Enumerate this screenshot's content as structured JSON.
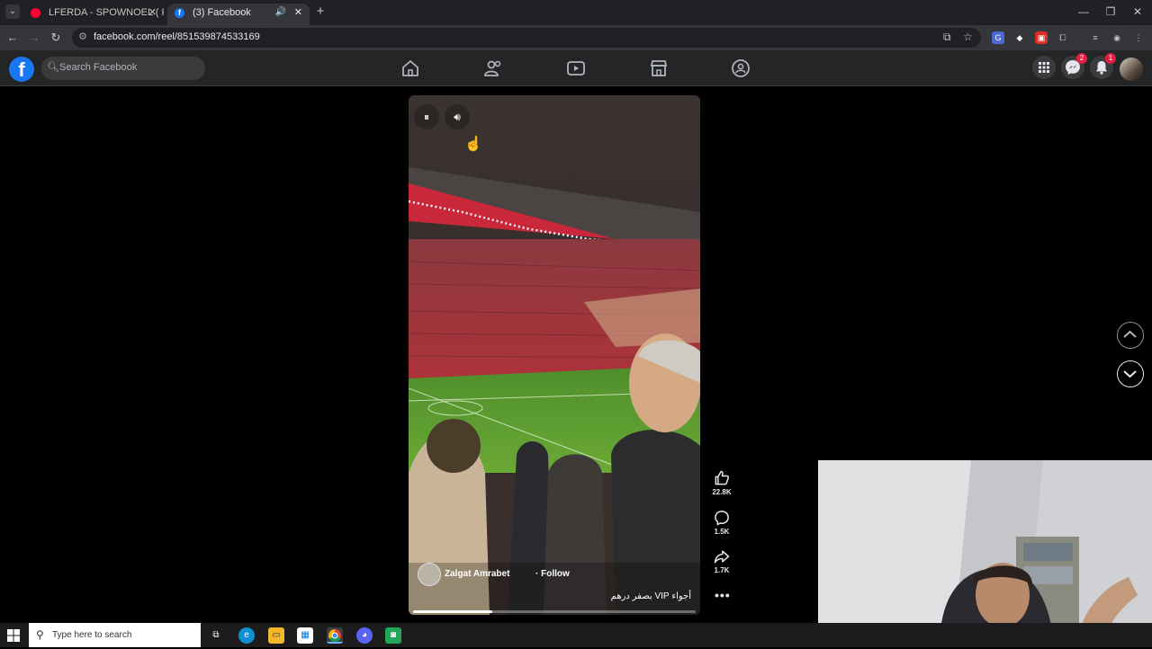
{
  "browser": {
    "tabs": [
      {
        "title": "LFERDA - SPOWNOEL ( PROD B",
        "active": false
      },
      {
        "title": "(3) Facebook",
        "active": true
      }
    ],
    "url": "facebook.com/reel/851539874533169"
  },
  "facebook": {
    "search_placeholder": "Search Facebook",
    "nav": [
      "home-icon",
      "friends-icon",
      "watch-icon",
      "marketplace-icon",
      "groups-icon"
    ],
    "messenger_badge": "2",
    "notifications_badge": "1"
  },
  "reel": {
    "owner": "Zalgat Amrabet",
    "follow_label": "· Follow",
    "caption": "أجواء VIP بصفر درهم",
    "progress": 0.28,
    "likes": "22.8K",
    "comments": "1.5K",
    "shares": "1.7K"
  },
  "taskbar": {
    "search_placeholder": "Type here to search"
  },
  "colors": {
    "facebook_blue": "#1877f2",
    "badge_red": "#e41e3f",
    "header_bg": "#242526"
  }
}
